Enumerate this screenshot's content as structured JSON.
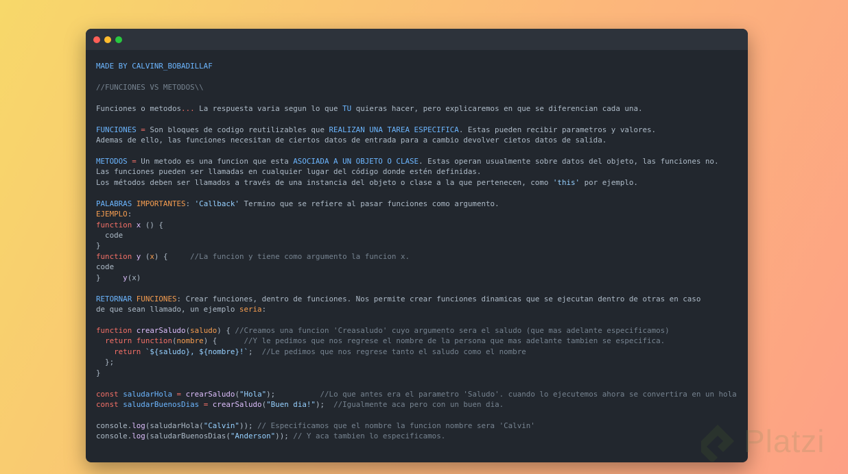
{
  "window": {
    "controls": {
      "close_color": "#ff5f57",
      "minimize_color": "#febc2e",
      "maximize_color": "#28c840"
    }
  },
  "lines": [
    {
      "segs": [
        {
          "t": "MADE BY CALVINR_BOBADILLAF",
          "c": "b"
        }
      ]
    },
    {
      "segs": []
    },
    {
      "segs": [
        {
          "t": "//FUNCIONES VS METODOS\\\\",
          "c": "c"
        }
      ]
    },
    {
      "segs": []
    },
    {
      "segs": [
        {
          "t": "Funciones o metodos",
          "c": "t"
        },
        {
          "t": "...",
          "c": "k"
        },
        {
          "t": " La respuesta varia segun lo que ",
          "c": "t"
        },
        {
          "t": "TU",
          "c": "b"
        },
        {
          "t": " quieras hacer, pero explicaremos en que se diferencian cada una.",
          "c": "t"
        }
      ]
    },
    {
      "segs": []
    },
    {
      "segs": [
        {
          "t": "FUNCIONES",
          "c": "b"
        },
        {
          "t": " = ",
          "c": "k"
        },
        {
          "t": "Son bloques de codigo reutilizables que ",
          "c": "t"
        },
        {
          "t": "REALIZAN UNA TAREA ESPECIFICA",
          "c": "b"
        },
        {
          "t": ". Estas pueden recibir parametros y valores.",
          "c": "t"
        }
      ]
    },
    {
      "segs": [
        {
          "t": "Ademas de ello, las funciones necesitan de ciertos datos de entrada para a cambio devolver cietos datos de salida.",
          "c": "t"
        }
      ]
    },
    {
      "segs": []
    },
    {
      "segs": [
        {
          "t": "METODOS",
          "c": "b"
        },
        {
          "t": " = ",
          "c": "k"
        },
        {
          "t": "Un metodo es una funcion que esta ",
          "c": "t"
        },
        {
          "t": "ASOCIADA A UN OBJETO O CLASE",
          "c": "b"
        },
        {
          "t": ". Estas operan usualmente sobre datos del objeto, las funciones no.",
          "c": "t"
        }
      ]
    },
    {
      "segs": [
        {
          "t": "Las funciones pueden ser llamadas en cualquier lugar del código donde estén definidas.",
          "c": "t"
        }
      ]
    },
    {
      "segs": [
        {
          "t": "Los métodos deben ser llamados a través de una instancia del objeto o clase a la que pertenecen, como ",
          "c": "t"
        },
        {
          "t": "'this'",
          "c": "s"
        },
        {
          "t": " por ejemplo.",
          "c": "t"
        }
      ]
    },
    {
      "segs": []
    },
    {
      "segs": [
        {
          "t": "PALABRAS",
          "c": "b"
        },
        {
          "t": " ",
          "c": "t"
        },
        {
          "t": "IMPORTANTES",
          "c": "o"
        },
        {
          "t": ": ",
          "c": "t"
        },
        {
          "t": "'Callback'",
          "c": "s"
        },
        {
          "t": " Termino que se refiere al pasar funciones como argumento.",
          "c": "t"
        }
      ]
    },
    {
      "segs": [
        {
          "t": "EJEMPLO",
          "c": "o"
        },
        {
          "t": ":",
          "c": "t"
        }
      ]
    },
    {
      "segs": [
        {
          "t": "function",
          "c": "k"
        },
        {
          "t": " ",
          "c": "t"
        },
        {
          "t": "x",
          "c": "p"
        },
        {
          "t": " () {",
          "c": "t"
        }
      ]
    },
    {
      "segs": [
        {
          "t": "  code",
          "c": "t"
        }
      ]
    },
    {
      "segs": [
        {
          "t": "}",
          "c": "t"
        }
      ]
    },
    {
      "segs": [
        {
          "t": "function",
          "c": "k"
        },
        {
          "t": " ",
          "c": "t"
        },
        {
          "t": "y",
          "c": "p"
        },
        {
          "t": " (",
          "c": "t"
        },
        {
          "t": "x",
          "c": "o"
        },
        {
          "t": ") {     ",
          "c": "t"
        },
        {
          "t": "//La funcion y tiene como argumento la funcion x.",
          "c": "c"
        }
      ]
    },
    {
      "segs": [
        {
          "t": "code",
          "c": "t"
        }
      ]
    },
    {
      "segs": [
        {
          "t": "}     ",
          "c": "t"
        },
        {
          "t": "y",
          "c": "p"
        },
        {
          "t": "(x)",
          "c": "t"
        }
      ]
    },
    {
      "segs": []
    },
    {
      "segs": [
        {
          "t": "RETORNAR",
          "c": "b"
        },
        {
          "t": " ",
          "c": "t"
        },
        {
          "t": "FUNCIONES",
          "c": "o"
        },
        {
          "t": ": Crear funciones, dentro de funciones. Nos permite crear funciones dinamicas que se ejecutan dentro de otras en caso",
          "c": "t"
        }
      ]
    },
    {
      "segs": [
        {
          "t": "de que sean llamado, un ejemplo ",
          "c": "t"
        },
        {
          "t": "seria",
          "c": "o"
        },
        {
          "t": ":",
          "c": "t"
        }
      ]
    },
    {
      "segs": []
    },
    {
      "segs": [
        {
          "t": "function",
          "c": "k"
        },
        {
          "t": " ",
          "c": "t"
        },
        {
          "t": "crearSaludo",
          "c": "p"
        },
        {
          "t": "(",
          "c": "t"
        },
        {
          "t": "saludo",
          "c": "o"
        },
        {
          "t": ") { ",
          "c": "t"
        },
        {
          "t": "//Creamos una funcion 'Creasaludo' cuyo argumento sera el saludo (que mas adelante especificamos)",
          "c": "c"
        }
      ]
    },
    {
      "segs": [
        {
          "t": "  ",
          "c": "t"
        },
        {
          "t": "return",
          "c": "k"
        },
        {
          "t": " ",
          "c": "t"
        },
        {
          "t": "function",
          "c": "k"
        },
        {
          "t": "(",
          "c": "t"
        },
        {
          "t": "nombre",
          "c": "o"
        },
        {
          "t": ") {      ",
          "c": "t"
        },
        {
          "t": "//Y le pedimos que nos regrese el nombre de la persona que mas adelante tambien se especifica.",
          "c": "c"
        }
      ]
    },
    {
      "segs": [
        {
          "t": "    ",
          "c": "t"
        },
        {
          "t": "return",
          "c": "k"
        },
        {
          "t": " ",
          "c": "t"
        },
        {
          "t": "`${saludo}, ${nombre}!`",
          "c": "s"
        },
        {
          "t": ";  ",
          "c": "t"
        },
        {
          "t": "//Le pedimos que nos regrese tanto el saludo como el nombre",
          "c": "c"
        }
      ]
    },
    {
      "segs": [
        {
          "t": "  };",
          "c": "t"
        }
      ]
    },
    {
      "segs": [
        {
          "t": "}",
          "c": "t"
        }
      ]
    },
    {
      "segs": []
    },
    {
      "segs": [
        {
          "t": "const",
          "c": "k"
        },
        {
          "t": " ",
          "c": "t"
        },
        {
          "t": "saludarHola",
          "c": "b"
        },
        {
          "t": " = ",
          "c": "k"
        },
        {
          "t": "crearSaludo",
          "c": "p"
        },
        {
          "t": "(",
          "c": "t"
        },
        {
          "t": "\"Hola\"",
          "c": "s"
        },
        {
          "t": ");          ",
          "c": "t"
        },
        {
          "t": "//Lo que antes era el parametro 'Saludo'. cuando lo ejecutemos ahora se convertira en un hola",
          "c": "c"
        }
      ]
    },
    {
      "segs": [
        {
          "t": "const",
          "c": "k"
        },
        {
          "t": " ",
          "c": "t"
        },
        {
          "t": "saludarBuenosDias",
          "c": "b"
        },
        {
          "t": " = ",
          "c": "k"
        },
        {
          "t": "crearSaludo",
          "c": "p"
        },
        {
          "t": "(",
          "c": "t"
        },
        {
          "t": "\"Buen dia!\"",
          "c": "s"
        },
        {
          "t": ");  ",
          "c": "t"
        },
        {
          "t": "//Igualmente aca pero con un buen dia.",
          "c": "c"
        }
      ]
    },
    {
      "segs": []
    },
    {
      "segs": [
        {
          "t": "console.",
          "c": "t"
        },
        {
          "t": "log",
          "c": "p"
        },
        {
          "t": "(saludarHola(",
          "c": "t"
        },
        {
          "t": "\"Calvin\"",
          "c": "s"
        },
        {
          "t": ")); ",
          "c": "t"
        },
        {
          "t": "// Especificamos que el nombre la funcion nombre sera 'Calvin'",
          "c": "c"
        }
      ]
    },
    {
      "segs": [
        {
          "t": "console.",
          "c": "t"
        },
        {
          "t": "log",
          "c": "p"
        },
        {
          "t": "(saludarBuenosDias(",
          "c": "t"
        },
        {
          "t": "\"Anderson\"",
          "c": "s"
        },
        {
          "t": ")); ",
          "c": "t"
        },
        {
          "t": "// Y aca tambien lo especificamos.",
          "c": "c"
        }
      ]
    }
  ],
  "watermark": {
    "text": "Platzi",
    "icon": "platzi-logo-icon"
  }
}
